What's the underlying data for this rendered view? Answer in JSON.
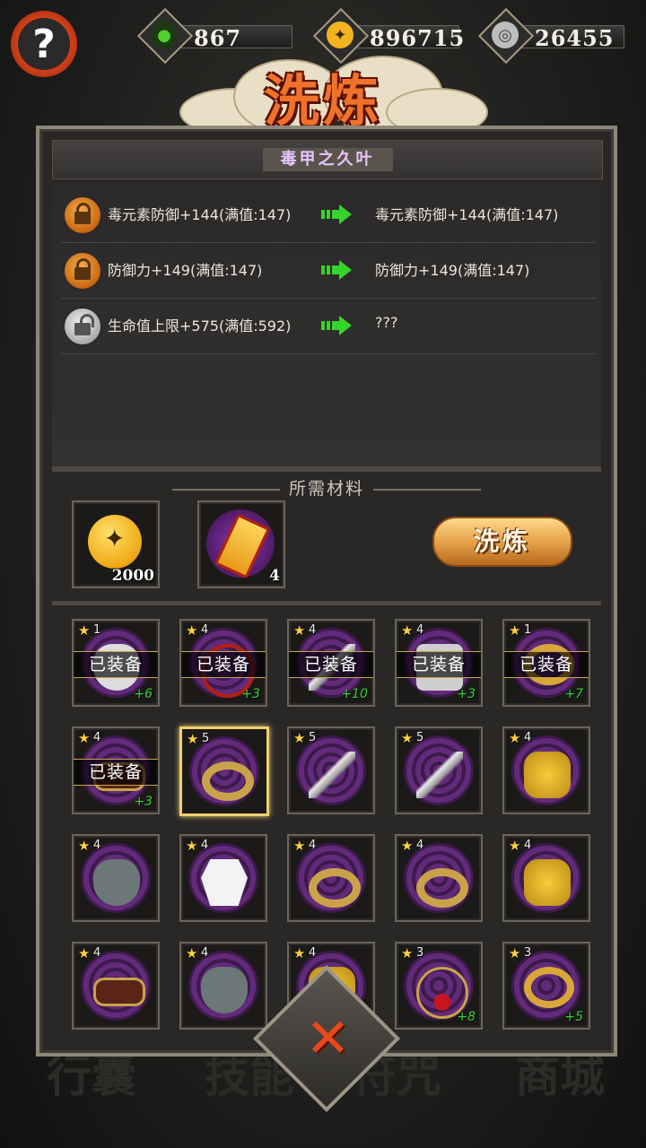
{
  "top": {
    "help_icon": "question-icon",
    "resources": [
      {
        "icon": "jade-icon",
        "value": "867",
        "color": "#4fd12e"
      },
      {
        "icon": "gold-coin-icon",
        "value": "896715",
        "color": "#f3b320"
      },
      {
        "icon": "silver-coin-icon",
        "value": "26455",
        "color": "#cfcfcf"
      }
    ]
  },
  "title": "洗炼",
  "item_name": "毒甲之久叶",
  "attributes": [
    {
      "locked": true,
      "current": "毒元素防御+144(满值:147)",
      "result": "毒元素防御+144(满值:147)"
    },
    {
      "locked": true,
      "current": "防御力+149(满值:147)",
      "result": "防御力+149(满值:147)"
    },
    {
      "locked": false,
      "current": "生命值上限+575(满值:592)",
      "result": "???"
    }
  ],
  "materials_label": "所需材料",
  "materials": [
    {
      "icon": "gold-coin-icon",
      "count": "2000"
    },
    {
      "icon": "refine-scroll-icon",
      "count": "4"
    }
  ],
  "refine_button": "洗炼",
  "equipped_label": "已装备",
  "inventory": [
    {
      "stars": "1",
      "equipped": true,
      "plus": "+6",
      "icon": "mask-icon"
    },
    {
      "stars": "4",
      "equipped": true,
      "plus": "+3",
      "icon": "necklace-icon"
    },
    {
      "stars": "4",
      "equipped": true,
      "plus": "+10",
      "icon": "blade-icon"
    },
    {
      "stars": "4",
      "equipped": true,
      "plus": "+3",
      "icon": "armor-icon"
    },
    {
      "stars": "1",
      "equipped": true,
      "plus": "+7",
      "icon": "ring-icon"
    },
    {
      "stars": "4",
      "equipped": true,
      "plus": "+3",
      "icon": "belt-icon"
    },
    {
      "stars": "5",
      "equipped": false,
      "plus": "",
      "icon": "gold-bracelet-icon",
      "selected": true
    },
    {
      "stars": "5",
      "equipped": false,
      "plus": "",
      "icon": "blade-icon"
    },
    {
      "stars": "5",
      "equipped": false,
      "plus": "",
      "icon": "blade-icon"
    },
    {
      "stars": "4",
      "equipped": false,
      "plus": "",
      "icon": "amulet-icon"
    },
    {
      "stars": "4",
      "equipped": false,
      "plus": "",
      "icon": "oni-mask-icon"
    },
    {
      "stars": "4",
      "equipped": false,
      "plus": "",
      "icon": "robe-icon"
    },
    {
      "stars": "4",
      "equipped": false,
      "plus": "",
      "icon": "gold-bracelet-icon"
    },
    {
      "stars": "4",
      "equipped": false,
      "plus": "",
      "icon": "gold-bracelet-icon"
    },
    {
      "stars": "4",
      "equipped": false,
      "plus": "",
      "icon": "amulet-icon"
    },
    {
      "stars": "4",
      "equipped": false,
      "plus": "",
      "icon": "belt-icon"
    },
    {
      "stars": "4",
      "equipped": false,
      "plus": "",
      "icon": "oni-mask-icon"
    },
    {
      "stars": "4",
      "equipped": false,
      "plus": "",
      "icon": "amulet-icon"
    },
    {
      "stars": "3",
      "equipped": false,
      "plus": "+8",
      "icon": "pendant-icon"
    },
    {
      "stars": "3",
      "equipped": false,
      "plus": "+5",
      "icon": "ring-icon"
    }
  ],
  "bottom_tabs": [
    "行囊",
    "技能",
    "符咒",
    "商城"
  ],
  "close_icon": "close-icon"
}
